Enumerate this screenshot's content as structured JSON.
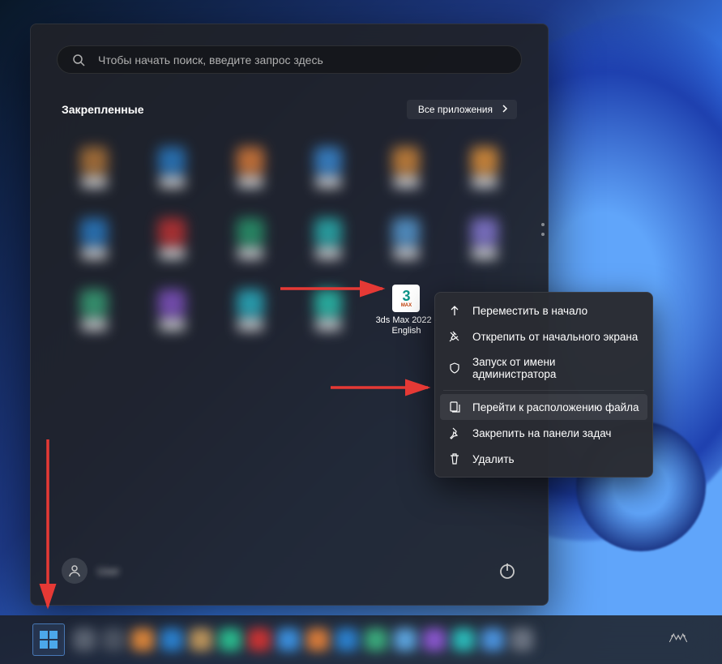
{
  "search": {
    "placeholder": "Чтобы начать поиск, введите запрос здесь"
  },
  "pinned": {
    "title": "Закрепленные",
    "all_apps_label": "Все приложения"
  },
  "apps": {
    "max_label": "3ds Max 2022 - English"
  },
  "context_menu": {
    "move_to_front": "Переместить в начало",
    "unpin_start": "Открепить от начального экрана",
    "run_as_admin": "Запуск от имени администратора",
    "open_file_location": "Перейти к расположению файла",
    "pin_to_taskbar": "Закрепить на панели задач",
    "delete": "Удалить"
  },
  "user": {
    "name": "User"
  },
  "colors": {
    "accent": "#4ca8ea",
    "arrow": "#e53935"
  },
  "tile_colors": [
    "#b97a3a",
    "#2b7ec9",
    "#e07e3a",
    "#3b8dd9",
    "#d68a3a",
    "#e8963a",
    "#2b7ec9",
    "#c73333",
    "#2a9b6f",
    "#2bb5b5",
    "#5aa0d9",
    "#8a7cd9",
    "#3aa67a",
    "#8655c9",
    "#2bb5c7",
    "#2bc9b5"
  ]
}
